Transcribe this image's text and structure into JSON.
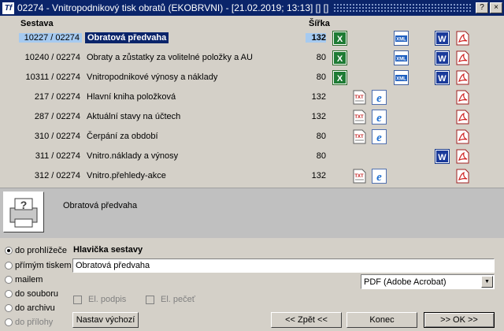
{
  "window": {
    "icon": "Tf",
    "title": "02274 - Vnitropodnikový tisk obratů (EKOBRVNI) - [21.02.2019; 13:13] [] []",
    "buttons": [
      "?",
      "×"
    ]
  },
  "list": {
    "col_sestava": "Sestava",
    "col_sirka": "Šířka",
    "rows": [
      {
        "code": "10227 / 02274",
        "name": "Obratová předvaha",
        "width": "132",
        "selected": true,
        "icons": [
          "xls",
          "xml",
          "word",
          "pdf"
        ]
      },
      {
        "code": "10240 / 02274",
        "name": "Obraty a zůstatky za volitelné položky a AU",
        "width": "80",
        "icons": [
          "xls",
          "xml",
          "word",
          "pdf"
        ]
      },
      {
        "code": "10311 / 02274",
        "name": "Vnitropodnikové výnosy a náklady",
        "width": "80",
        "icons": [
          "xls",
          "xml",
          "word",
          "pdf"
        ]
      },
      {
        "code": "217 / 02274",
        "name": "Hlavní kniha položková",
        "width": "132",
        "icons": [
          "txt",
          "ie",
          "pdf"
        ]
      },
      {
        "code": "287 / 02274",
        "name": "Aktuální stavy na účtech",
        "width": "132",
        "icons": [
          "txt",
          "ie",
          "pdf"
        ]
      },
      {
        "code": "310 / 02274",
        "name": "Čerpání za období",
        "width": "80",
        "icons": [
          "txt",
          "ie",
          "pdf"
        ]
      },
      {
        "code": "311 / 02274",
        "name": "Vnitro.náklady a výnosy",
        "width": "80",
        "icons": [
          "word",
          "pdf"
        ]
      },
      {
        "code": "312 / 02274",
        "name": "Vnitro.přehledy-akce",
        "width": "132",
        "icons": [
          "txt",
          "ie",
          "pdf"
        ]
      }
    ]
  },
  "description": {
    "icon": "printer-icon",
    "text": "Obratová předvaha"
  },
  "output": {
    "options": [
      {
        "label": "do prohlížeče",
        "selected": true,
        "enabled": true
      },
      {
        "label": "přímým tiskem",
        "selected": false,
        "enabled": true
      },
      {
        "label": "mailem",
        "selected": false,
        "enabled": true
      },
      {
        "label": "do souboru",
        "selected": false,
        "enabled": true
      },
      {
        "label": "do archivu",
        "selected": false,
        "enabled": true
      },
      {
        "label": "do přílohy",
        "selected": false,
        "enabled": false
      }
    ],
    "header_label": "Hlavička sestavy",
    "header_value": "Obratová předvaha",
    "format_selected": "PDF (Adobe Acrobat)",
    "el_podpis": "El. podpis",
    "el_pecet": "El. pečeť"
  },
  "buttons": {
    "nastav": "Nastav výchozí",
    "zpet": "<< Zpět <<",
    "konec": "Konec",
    "ok": ">> OK >>"
  }
}
